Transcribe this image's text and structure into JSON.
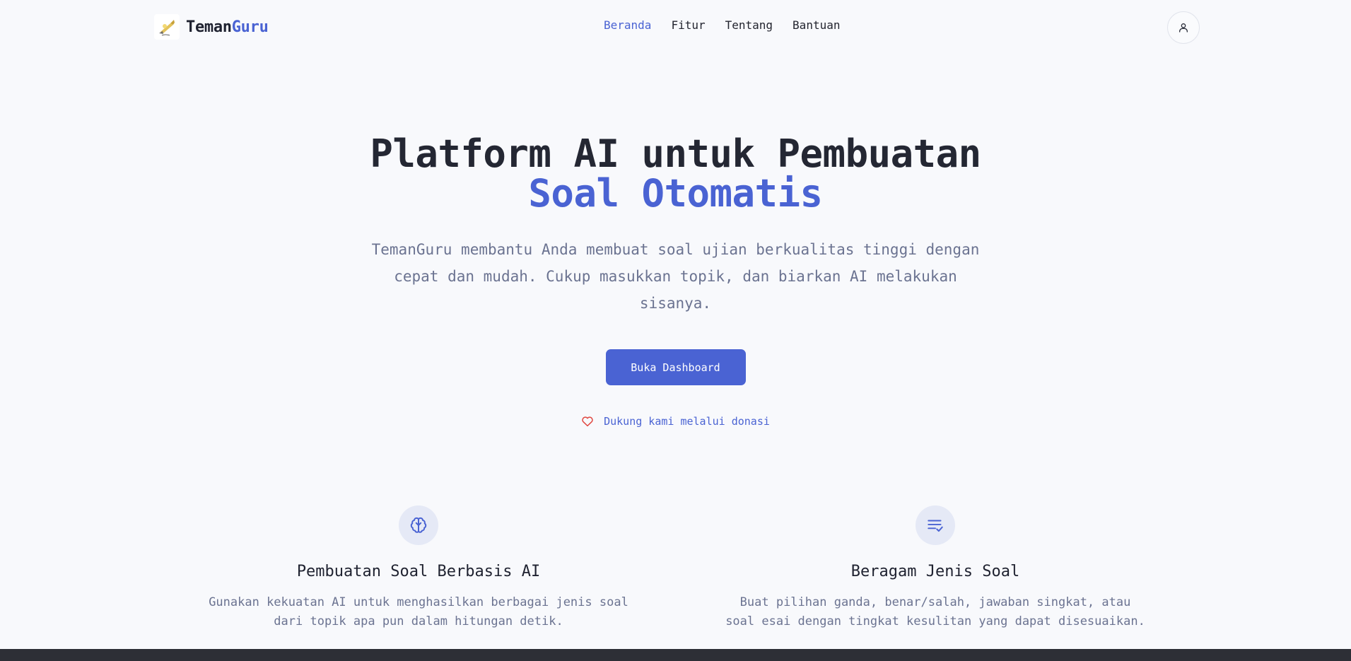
{
  "brand": {
    "name_part1": "Teman",
    "name_part2": "Guru"
  },
  "nav": {
    "items": [
      {
        "label": "Beranda",
        "active": true
      },
      {
        "label": "Fitur",
        "active": false
      },
      {
        "label": "Tentang",
        "active": false
      },
      {
        "label": "Bantuan",
        "active": false
      }
    ]
  },
  "hero": {
    "title_line1": "Platform AI untuk Pembuatan",
    "title_line2": "Soal Otomatis",
    "description": "TemanGuru membantu Anda membuat soal ujian berkualitas tinggi dengan cepat dan mudah. Cukup masukkan topik, dan biarkan AI melakukan sisanya.",
    "cta_label": "Buka Dashboard",
    "donate_label": "Dukung kami melalui donasi"
  },
  "features": [
    {
      "icon": "brain-icon",
      "title": "Pembuatan Soal Berbasis AI",
      "description": "Gunakan kekuatan AI untuk menghasilkan berbagai jenis soal dari topik apa pun dalam hitungan detik."
    },
    {
      "icon": "list-check-icon",
      "title": "Beragam Jenis Soal",
      "description": "Buat pilihan ganda, benar/salah, jawaban singkat, atau soal esai dengan tingkat kesulitan yang dapat disesuaikan."
    }
  ],
  "colors": {
    "accent": "#4a63d3",
    "background": "#f8f9fc",
    "heart": "#e0463f"
  }
}
